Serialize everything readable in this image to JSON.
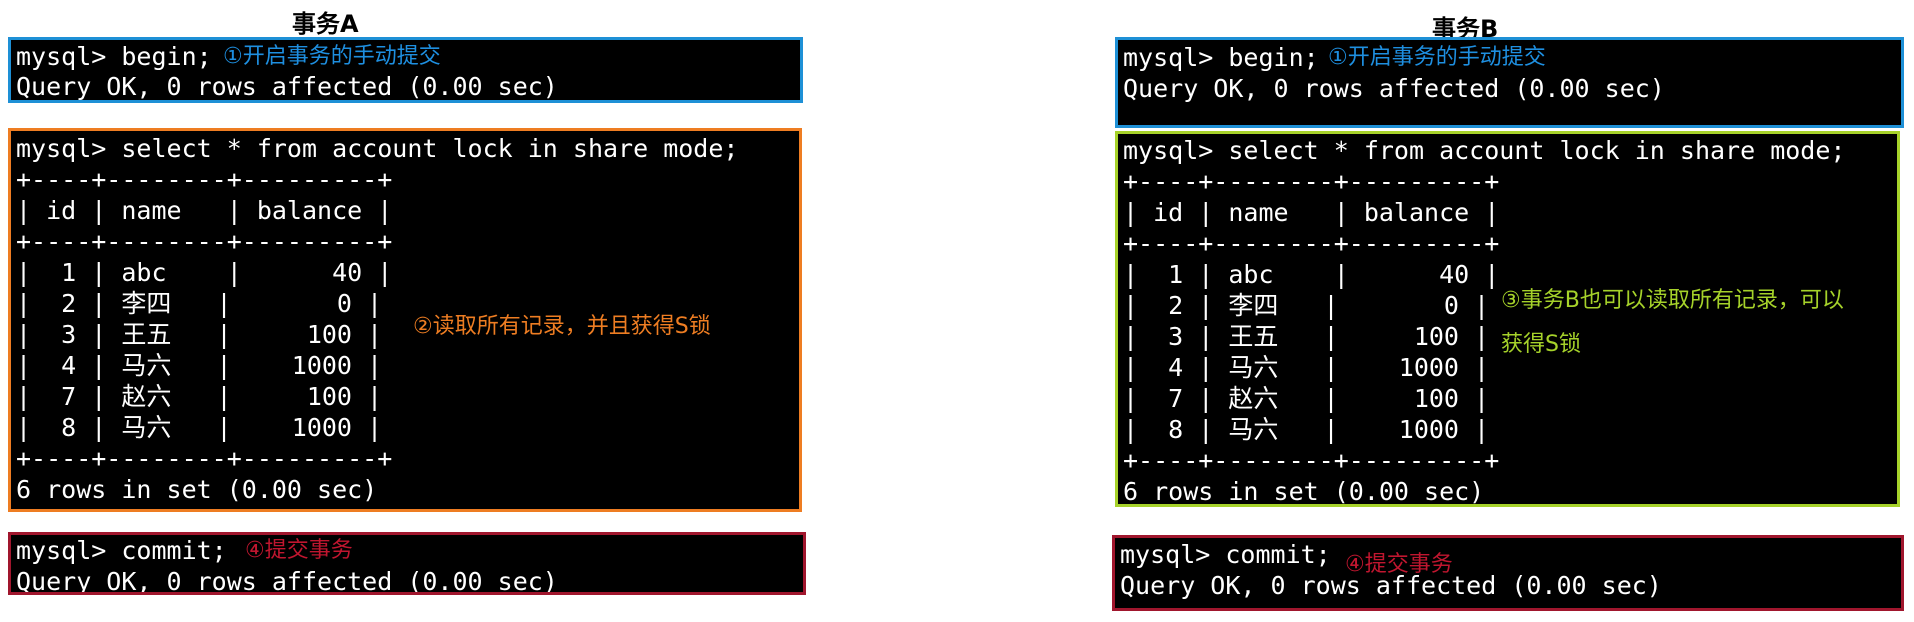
{
  "transaction_a": {
    "title": "事务A",
    "begin_block": {
      "lines": [
        "mysql> begin;",
        "Query OK, 0 rows affected (0.00 sec)"
      ],
      "annotation": "①开启事务的手动提交"
    },
    "select_block": {
      "lines": [
        "mysql> select * from account lock in share mode;",
        "+----+--------+---------+",
        "| id | name   | balance |",
        "+----+--------+---------+",
        "|  1 | abc    |      40 |",
        "|  2 | 李四   |       0 |",
        "|  3 | 王五   |     100 |",
        "|  4 | 马六   |    1000 |",
        "|  7 | 赵六   |     100 |",
        "|  8 | 马六   |    1000 |",
        "+----+--------+---------+",
        "6 rows in set (0.00 sec)"
      ],
      "annotation": "②读取所有记录，并且获得S锁"
    },
    "commit_block": {
      "lines": [
        "mysql> commit;",
        "Query OK, 0 rows affected (0.00 sec)"
      ],
      "annotation": "④提交事务"
    }
  },
  "transaction_b": {
    "title": "事务B",
    "begin_block": {
      "lines": [
        "mysql> begin;",
        "Query OK, 0 rows affected (0.00 sec)"
      ],
      "annotation": "①开启事务的手动提交"
    },
    "select_block": {
      "lines": [
        "mysql> select * from account lock in share mode;",
        "+----+--------+---------+",
        "| id | name   | balance |",
        "+----+--------+---------+",
        "|  1 | abc    |      40 |",
        "|  2 | 李四   |       0 |",
        "|  3 | 王五   |     100 |",
        "|  4 | 马六   |    1000 |",
        "|  7 | 赵六   |     100 |",
        "|  8 | 马六   |    1000 |",
        "+----+--------+---------+",
        "6 rows in set (0.00 sec)"
      ],
      "annotation_lines": [
        "③事务B也可以读取所有记录，可以",
        "获得S锁"
      ]
    },
    "commit_block": {
      "lines": [
        "mysql> commit;",
        "Query OK, 0 rows affected (0.00 sec)"
      ],
      "annotation": "④提交事务"
    }
  },
  "colors": {
    "blue": "#1e90d6",
    "orange": "#ee7d22",
    "lime": "#a6d22a",
    "maroon": "#a0162d"
  }
}
